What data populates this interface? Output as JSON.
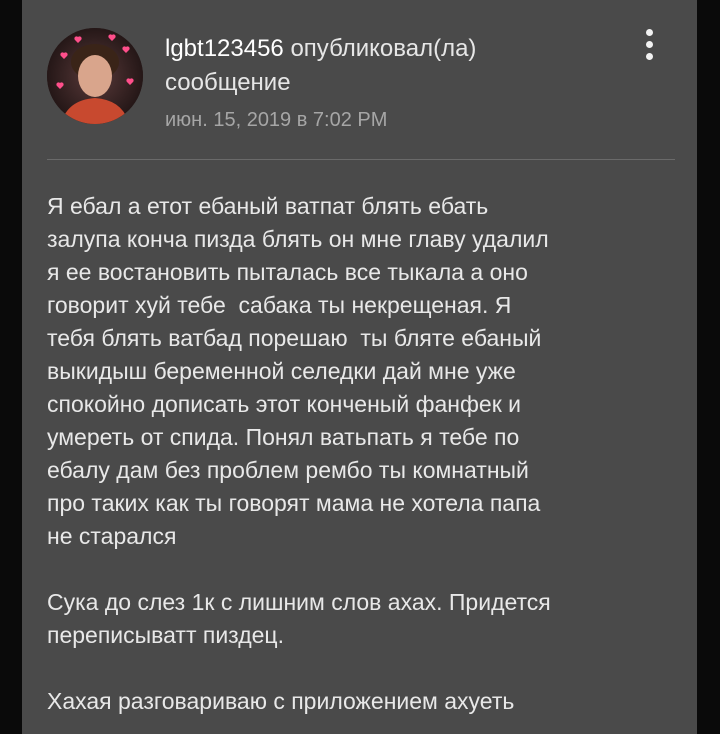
{
  "post": {
    "username": "lgbt123456",
    "action_line1": " опубликовал(ла)",
    "action_line2": "сообщение",
    "timestamp": "июн. 15, 2019 в 7:02 PM",
    "menu_icon": "more-vertical-icon"
  },
  "message": {
    "paragraph1": [
      "Я ебал а етот ебаный ватпат блять ебать",
      "залупа конча пизда блять он мне главу удалил",
      "я ее востановить пыталась все тыкала а оно",
      "говорит хуй тебе  сабака ты некрещеная. Я",
      "тебя блять ватбад порешаю  ты бляте ебаный",
      "выкидыш беременной селедки дай мне уже",
      "спокойно дописать этот конченый фанфек и",
      "умереть от спида. Понял ватьпать я тебе по",
      "ебалу дам без проблем рембо ты комнатный",
      "про таких как ты говорят мама не хотела папа",
      "не старался"
    ],
    "paragraph2": [
      "Сука до слез 1к с лишним слов ахах. Придется",
      "переписыватт пиздец."
    ],
    "paragraph3": [
      "Хахая разговариваю с приложением ахуеть"
    ]
  },
  "colors": {
    "card_background": "#4a4a4a",
    "page_background": "#0a0a0a",
    "text_primary": "#e8e8e8",
    "text_secondary": "#a6a6a6"
  }
}
